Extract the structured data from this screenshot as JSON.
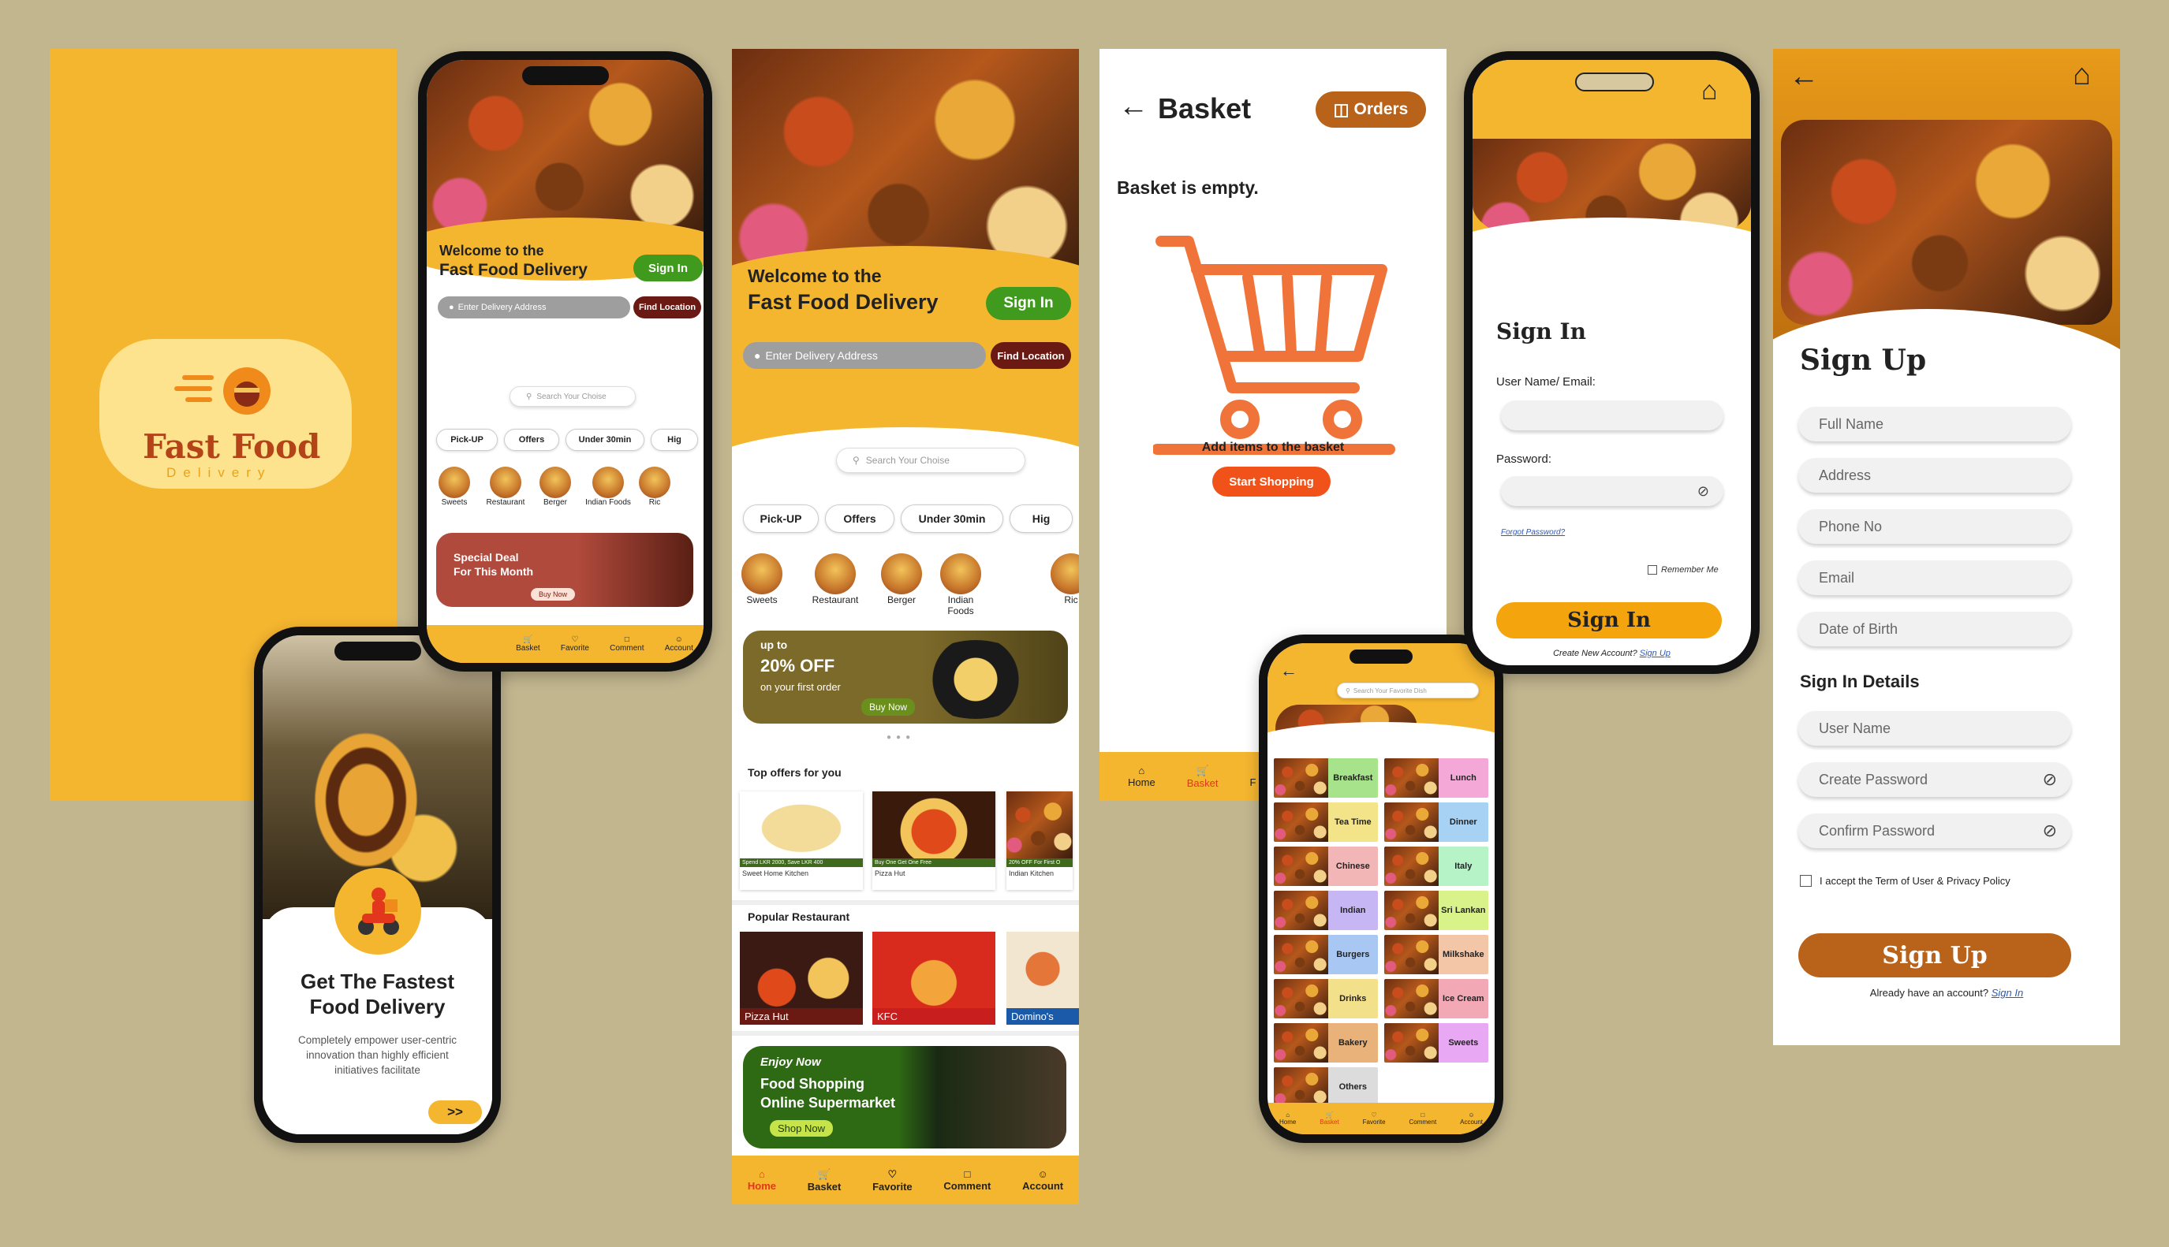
{
  "colors": {
    "bg": "#c2b68f",
    "brand": "#f4b52f",
    "green": "#3f9a1d",
    "darkred": "#6a1a12",
    "orange": "#f4a40c",
    "brown": "#b9621a"
  },
  "splash": {
    "logo_title": "Fast Food",
    "logo_sub": "Delivery"
  },
  "onboard": {
    "title1": "Get The Fastest",
    "title2": "Food Delivery",
    "desc1": "Completely empower user-centric",
    "desc2": "innovation than highly efficient",
    "desc3": "initiatives facilitate",
    "next": ">>"
  },
  "home": {
    "welcome1": "Welcome to the",
    "welcome2": "Fast Food Delivery",
    "signin": "Sign In",
    "address_placeholder": "Enter Delivery Address",
    "find": "Find Location",
    "search": "Search Your Choise",
    "chips": [
      "Pick-UP",
      "Offers",
      "Under 30min",
      "Hig"
    ],
    "cats": [
      "Sweets",
      "Restaurant",
      "Berger",
      "Indian Foods",
      "Ric"
    ],
    "deal1": "Special Deal",
    "deal2": "For This Month",
    "buy": "Buy Now",
    "nav": [
      "Home",
      "Basket",
      "Favorite",
      "Comment",
      "Account"
    ]
  },
  "home_long": {
    "promo_up": "up to",
    "promo_pct": "20% OFF",
    "promo_first": "on your first order",
    "buy": "Buy Now",
    "top_offers": "Top offers for you",
    "offers": [
      {
        "tag": "Spend LKR 2000, Save LKR 400",
        "name": "Sweet Home Kitchen"
      },
      {
        "tag": "Buy One Get One Free",
        "name": "Pizza Hut"
      },
      {
        "tag": "20% OFF For First O",
        "name": "Indian Kitchen"
      }
    ],
    "popular": "Popular Restaurant",
    "restaurants": [
      "Pizza Hut",
      "KFC",
      "Domino's"
    ],
    "enjoy": "Enjoy Now",
    "shop1": "Food Shopping",
    "shop2": "Online Supermarket",
    "shop_btn": "Shop Now"
  },
  "basket": {
    "title": "Basket",
    "orders": "Orders",
    "empty": "Basket is empty.",
    "add": "Add items to the basket",
    "start": "Start Shopping",
    "nav": [
      "Home",
      "Basket",
      "F"
    ]
  },
  "categories": {
    "search": "Search Your Favorite Dish",
    "items": [
      {
        "l": "Breakfast",
        "c": "#a6e38a"
      },
      {
        "l": "Lunch",
        "c": "#f3a8d8"
      },
      {
        "l": "Tea Time",
        "c": "#f3e48a"
      },
      {
        "l": "Dinner",
        "c": "#a8d2f3"
      },
      {
        "l": "Chinese",
        "c": "#f3b6b6"
      },
      {
        "l": "Italy",
        "c": "#b6f3c6"
      },
      {
        "l": "Indian",
        "c": "#c6b6f3"
      },
      {
        "l": "Sri Lankan",
        "c": "#d9f38a"
      },
      {
        "l": "Burgers",
        "c": "#a8c8f3"
      },
      {
        "l": "Milkshake",
        "c": "#f3c6a8"
      },
      {
        "l": "Drinks",
        "c": "#f3e08a"
      },
      {
        "l": "Ice Cream",
        "c": "#f3a8b6"
      },
      {
        "l": "Bakery",
        "c": "#e8b27a"
      },
      {
        "l": "Sweets",
        "c": "#e8a8f3"
      },
      {
        "l": "Others",
        "c": "#dcdcdc"
      }
    ],
    "nav": [
      "Home",
      "Basket",
      "Favorite",
      "Comment",
      "Account"
    ]
  },
  "signin": {
    "title": "Sign In",
    "user_label": "User Name/ Email:",
    "pass_label": "Password:",
    "forgot": "Forgot Password?",
    "remember": "Remember Me",
    "btn": "Sign In",
    "create": "Create New Account?",
    "signup_link": "Sign Up"
  },
  "signup": {
    "title": "Sign Up",
    "fields": [
      "Full Name",
      "Address",
      "Phone No",
      "Email",
      "Date of Birth"
    ],
    "details": "Sign In Details",
    "fields2": [
      "User Name",
      "Create Password",
      "Confirm Password"
    ],
    "terms": "I accept the Term of User & Privacy Policy",
    "btn": "Sign Up",
    "have": "Already have an account?",
    "signin_link": "Sign In"
  }
}
